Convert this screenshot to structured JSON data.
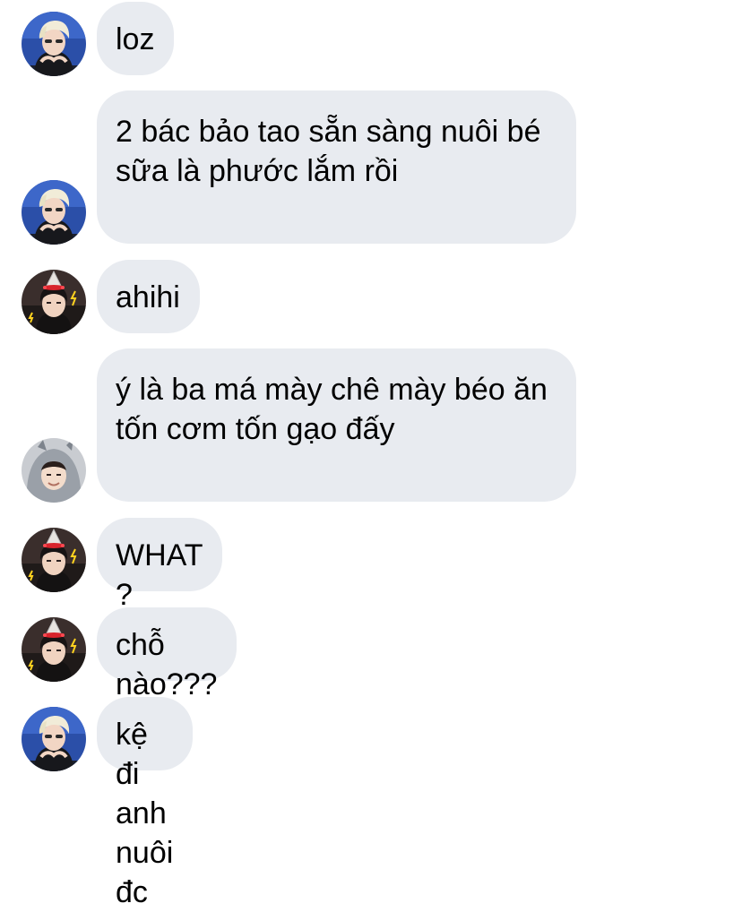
{
  "conversation": {
    "messages": [
      {
        "sender_avatar": "blond-hair-avatar",
        "text": "loz"
      },
      {
        "sender_avatar": "blond-hair-avatar",
        "text": "2 bác bảo tao sẵn sàng nuôi bé sữa là phước lắm rồi"
      },
      {
        "sender_avatar": "dark-hair-party-hat-avatar",
        "text": "ahihi"
      },
      {
        "sender_avatar": "hooded-avatar",
        "text": "ý là ba má mày chê mày béo ăn tốn cơm tốn gạo đấy"
      },
      {
        "sender_avatar": "dark-hair-party-hat-avatar",
        "text": "WHAT ?"
      },
      {
        "sender_avatar": "dark-hair-party-hat-avatar",
        "text": "chỗ nào???"
      },
      {
        "sender_avatar": "blond-hair-avatar",
        "text": "kệ đi anh nuôi đc"
      }
    ]
  },
  "colors": {
    "bubble_background": "#e8ebf0",
    "text": "#000000",
    "page_background": "#ffffff"
  }
}
